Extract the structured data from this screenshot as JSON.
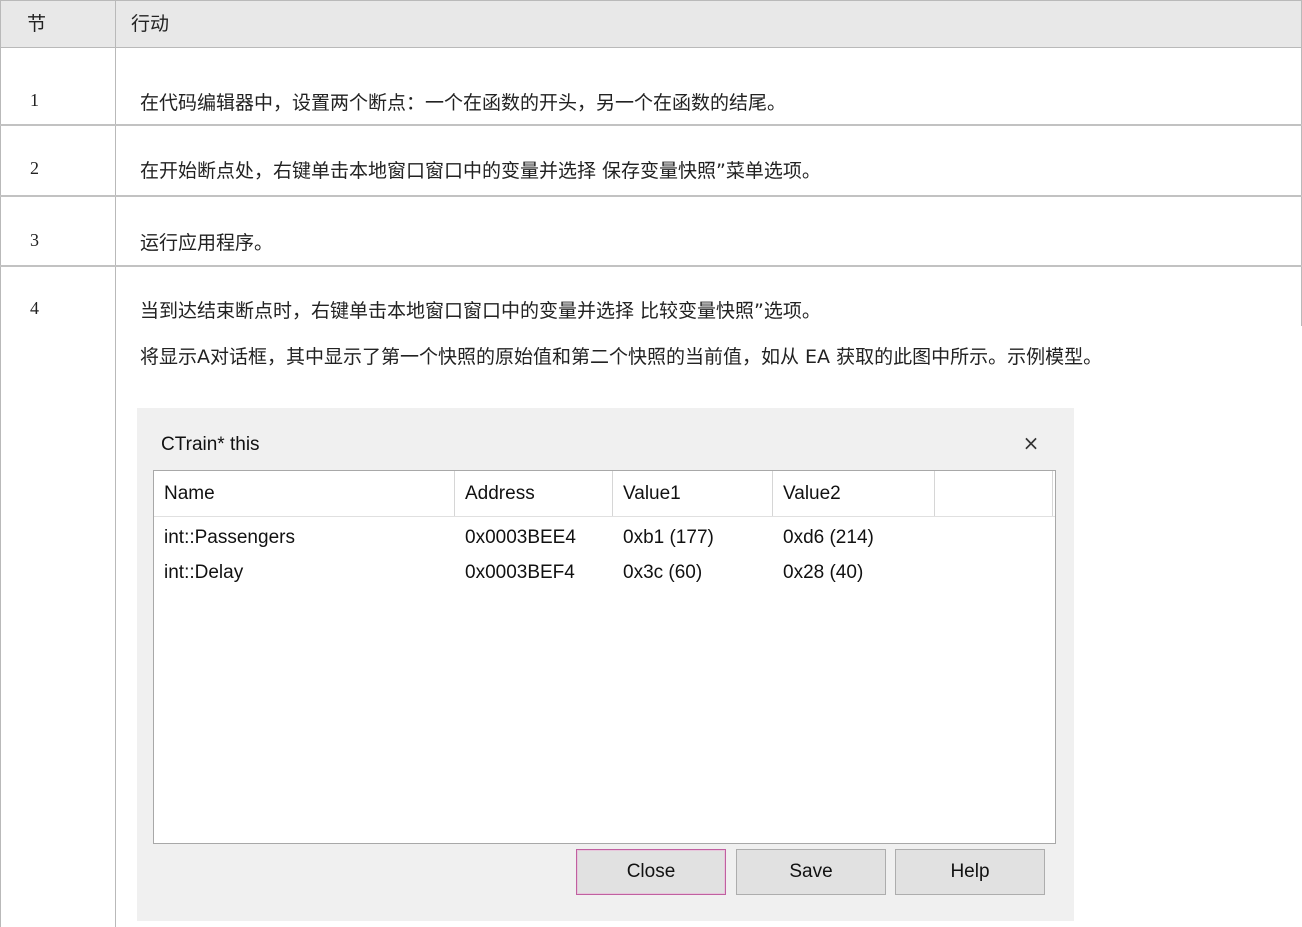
{
  "table": {
    "header": {
      "col_section": "节",
      "col_action": "行动"
    },
    "rows": [
      {
        "num": "1",
        "text": "在代码编辑器中，设置两个断点：一个在函数的开头，另一个在函数的结尾。"
      },
      {
        "num": "2",
        "text": "在开始断点处，右键单击本地窗口窗口中的变量并选择 保存变量快照”菜单选项。"
      },
      {
        "num": "3",
        "text": "运行应用程序。"
      },
      {
        "num": "4",
        "text": "当到达结束断点时，右键单击本地窗口窗口中的变量并选择 比较变量快照”选项。",
        "text2": "将显示A对话框，其中显示了第一个快照的原始值和第二个快照的当前值，如从 EA 获取的此图中所示。示例模型。"
      }
    ]
  },
  "dialog": {
    "title": "CTrain* this",
    "close_glyph": "×",
    "columns": [
      "Name",
      "Address",
      "Value1",
      "Value2",
      ""
    ],
    "rows": [
      {
        "name": "int::Passengers",
        "address": "0x0003BEE4",
        "value1": "0xb1 (177)",
        "value2": "0xd6 (214)"
      },
      {
        "name": "int::Delay",
        "address": "0x0003BEF4",
        "value1": "0x3c (60)",
        "value2": "0x28 (40)"
      }
    ],
    "buttons": {
      "close": "Close",
      "save": "Save",
      "help": "Help"
    }
  }
}
